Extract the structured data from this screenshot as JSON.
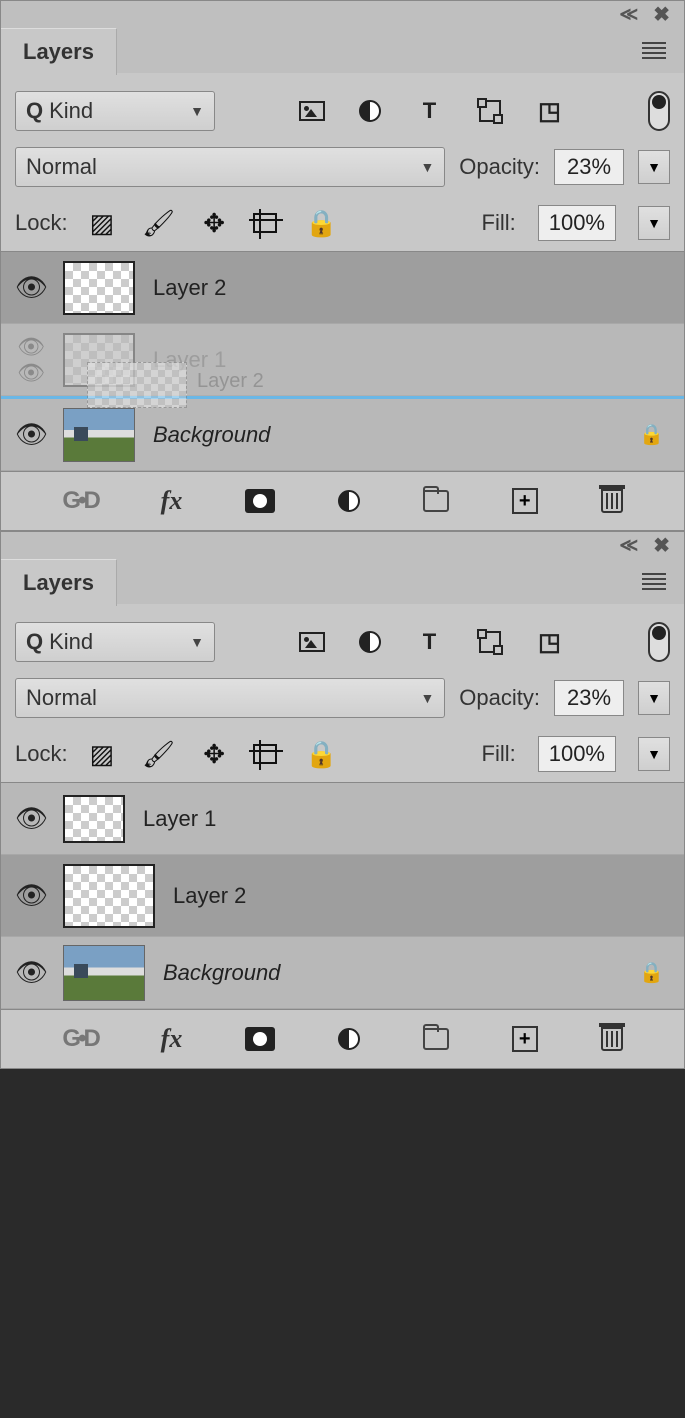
{
  "panel1": {
    "title": "Layers",
    "filter_label": "Kind",
    "blend_mode": "Normal",
    "opacity_label": "Opacity:",
    "opacity_value": "23%",
    "lock_label": "Lock:",
    "fill_label": "Fill:",
    "fill_value": "100%",
    "layers": [
      {
        "name": "Layer 2",
        "visible": true,
        "selected": true,
        "locked": false,
        "thumb": "transparent"
      },
      {
        "name": "Layer 1",
        "visible": "linked",
        "selected": false,
        "locked": false,
        "thumb": "transparent",
        "dragging_ghost": "Layer 2"
      },
      {
        "name": "Background",
        "visible": true,
        "selected": false,
        "locked": true,
        "thumb": "photo",
        "italic": true
      }
    ]
  },
  "panel2": {
    "title": "Layers",
    "filter_label": "Kind",
    "blend_mode": "Normal",
    "opacity_label": "Opacity:",
    "opacity_value": "23%",
    "lock_label": "Lock:",
    "fill_label": "Fill:",
    "fill_value": "100%",
    "layers": [
      {
        "name": "Layer 1",
        "visible": true,
        "selected": false,
        "locked": false,
        "thumb": "transparent"
      },
      {
        "name": "Layer 2",
        "visible": true,
        "selected": true,
        "locked": false,
        "thumb": "transparent"
      },
      {
        "name": "Background",
        "visible": true,
        "selected": false,
        "locked": true,
        "thumb": "photo",
        "italic": true
      }
    ]
  },
  "toolbar": {
    "fx": "fx"
  }
}
